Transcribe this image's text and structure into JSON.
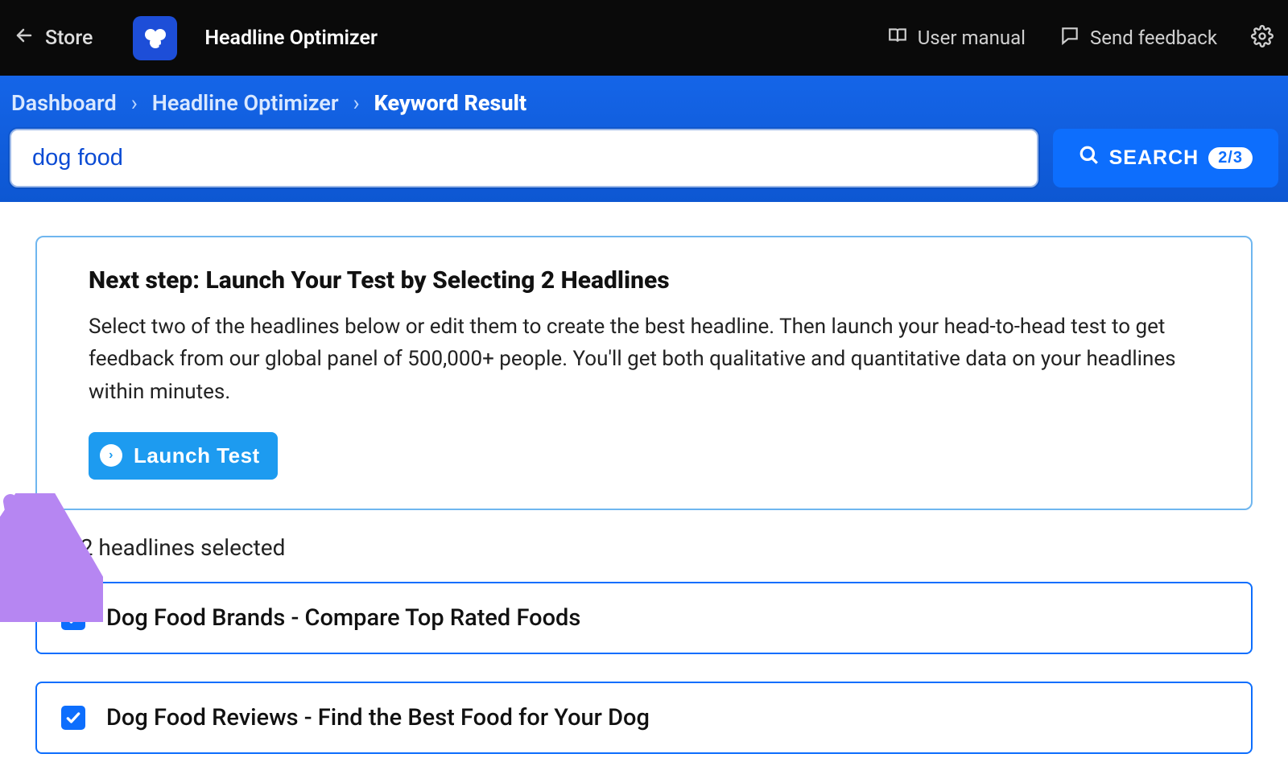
{
  "topbar": {
    "store": "Store",
    "app_title": "Headline Optimizer",
    "user_manual": "User manual",
    "send_feedback": "Send feedback"
  },
  "breadcrumb": {
    "items": [
      "Dashboard",
      "Headline Optimizer",
      "Keyword Result"
    ]
  },
  "search": {
    "value": "dog food",
    "button_label": "SEARCH",
    "badge": "2/3"
  },
  "callout": {
    "title": "Next step: Launch Your Test by Selecting 2 Headlines",
    "body": "Select two of the headlines below or edit them to create the best headline. Then launch your head-to-head test to get feedback from our global panel of 500,000+ people. You'll get both qualitative and quantitative data on your headlines within minutes.",
    "launch_label": "Launch Test"
  },
  "counter": {
    "selected": "2",
    "total_suffix": "/2 headlines selected"
  },
  "headlines": [
    {
      "text": "Dog Food Brands - Compare Top Rated Foods",
      "checked": true
    },
    {
      "text": "Dog Food Reviews - Find the Best Food for Your Dog",
      "checked": true
    }
  ]
}
